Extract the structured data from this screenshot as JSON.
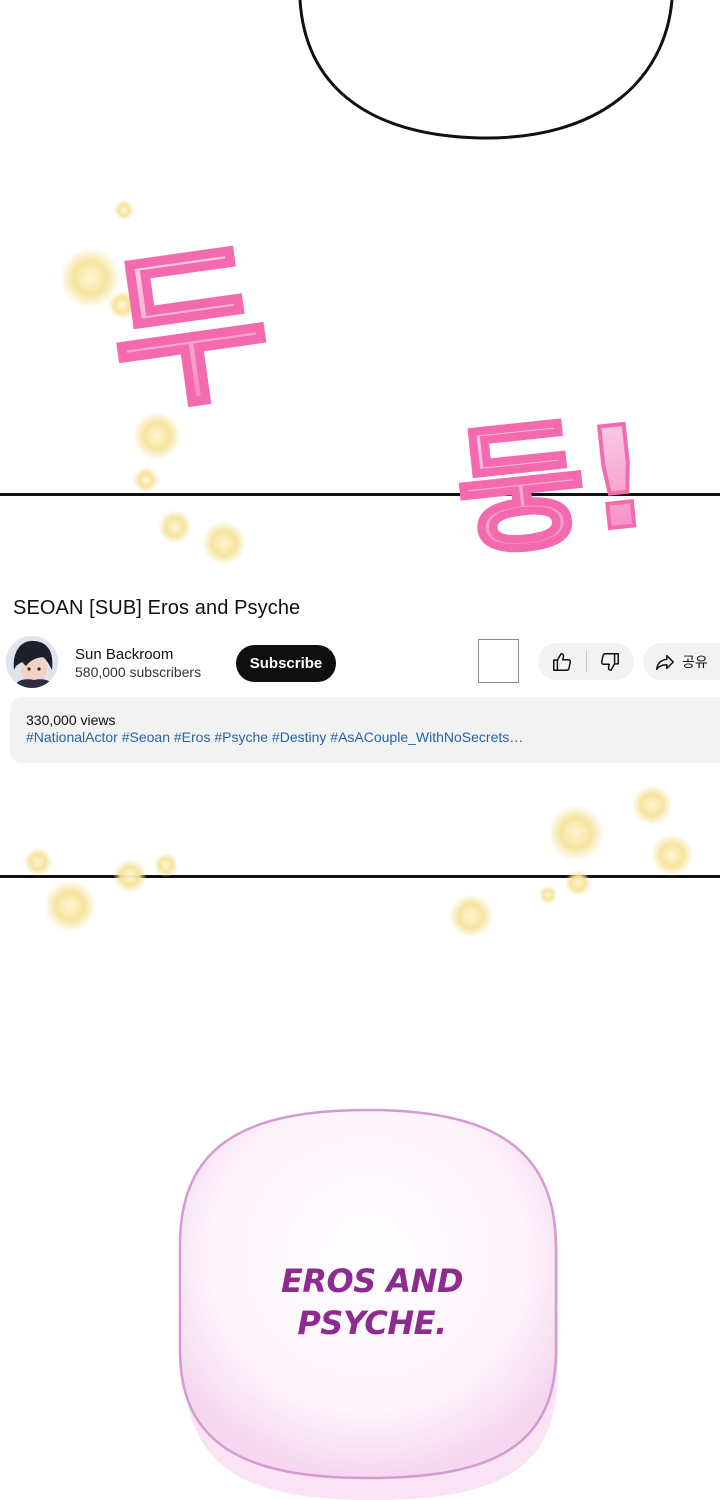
{
  "video": {
    "title": "SEOAN [SUB] Eros and Psyche",
    "channel_name": "Sun Backroom",
    "subscribers": "580,000 subscribers",
    "subscribe_label": "Subscribe",
    "share_label": "공유",
    "views": "330,000 views",
    "hashtags": "#NationalActor #Seoan #Eros #Psyche #Destiny #AsACouple_WithNoSecrets…"
  },
  "comic": {
    "sfx_1": "두",
    "sfx_2": "둥!",
    "bubble_line_1": "EROS AND",
    "bubble_line_2": "PSYCHE."
  },
  "icons": [
    "like-icon",
    "dislike-icon",
    "share-icon",
    "sparkle-icon"
  ],
  "colors": {
    "subscribe_bg": "#0f0f0f",
    "hashtag_text": "#2265ab",
    "pill_bg": "#f2f2f2",
    "sfx_pink": "#f57ab8",
    "bubble_text": "#8e2b90",
    "bubble_outline": "#d69ad2"
  }
}
